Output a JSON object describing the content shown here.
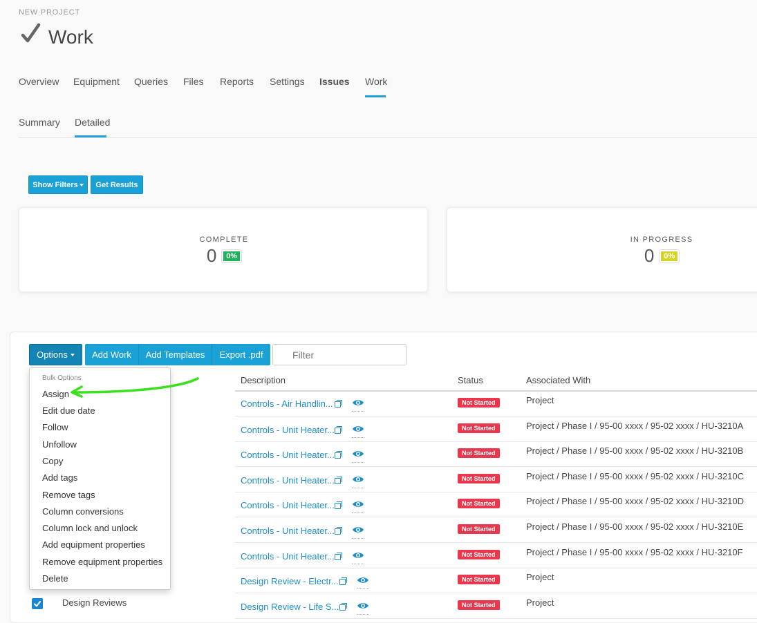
{
  "header": {
    "overline": "NEW PROJECT",
    "title": "Work"
  },
  "tabs": [
    "Overview",
    "Equipment",
    "Queries",
    "Files",
    "Reports",
    "Settings",
    "Issues",
    "Work"
  ],
  "subtabs": [
    "Summary",
    "Detailed"
  ],
  "buttons": {
    "show_filters": "Show Filters",
    "get_results": "Get Results"
  },
  "stats": {
    "complete": {
      "label": "COMPLETE",
      "value": "0",
      "pct": "0%",
      "color": "#1bb35a"
    },
    "in_progress": {
      "label": "IN PROGRESS",
      "value": "0",
      "pct": "0%",
      "color": "#d6d32a"
    }
  },
  "toolbar": {
    "options": "Options",
    "add_work": "Add Work",
    "add_templates": "Add Templates",
    "export": "Export .pdf",
    "filter_placeholder": "Filter"
  },
  "table": {
    "headers": {
      "description": "Description",
      "status": "Status",
      "associated": "Associated With"
    },
    "rows": [
      {
        "group": "",
        "desc": "Controls - Air Handlin...",
        "status": "Not Started",
        "assoc": "Project"
      },
      {
        "group": "",
        "desc": "Controls - Unit Heater...",
        "status": "Not Started",
        "assoc": "Project / Phase I / 95-00 xxxx / 95-02 xxxx / HU-3210A"
      },
      {
        "group": "",
        "desc": "Controls - Unit Heater...",
        "status": "Not Started",
        "assoc": "Project / Phase I / 95-00 xxxx / 95-02 xxxx / HU-3210B"
      },
      {
        "group": "",
        "desc": "Controls - Unit Heater...",
        "status": "Not Started",
        "assoc": "Project / Phase I / 95-00 xxxx / 95-02 xxxx / HU-3210C"
      },
      {
        "group": "",
        "desc": "Controls - Unit Heater...",
        "status": "Not Started",
        "assoc": "Project / Phase I / 95-00 xxxx / 95-02 xxxx / HU-3210D"
      },
      {
        "group": "",
        "desc": "Controls - Unit Heater...",
        "status": "Not Started",
        "assoc": "Project / Phase I / 95-00 xxxx / 95-02 xxxx / HU-3210E"
      },
      {
        "group": "",
        "desc": "Controls - Unit Heater...",
        "status": "Not Started",
        "assoc": "Project / Phase I / 95-00 xxxx / 95-02 xxxx / HU-3210F"
      },
      {
        "group": "",
        "desc": "Design Review - Electr...",
        "status": "Not Started",
        "assoc": "Project"
      },
      {
        "group": "Design Reviews",
        "desc": "Design Review - Life S...",
        "status": "Not Started",
        "assoc": "Project"
      }
    ]
  },
  "bulk_menu": {
    "header": "Bulk Options",
    "items": [
      "Assign",
      "Edit due date",
      "Follow",
      "Unfollow",
      "Copy",
      "Add tags",
      "Remove tags",
      "Column conversions",
      "Column lock and unlock",
      "Add equipment properties",
      "Remove equipment properties",
      "Delete"
    ]
  },
  "icons": {
    "title": "checkmark-icon",
    "copy": "copy-icon",
    "view": "eye-icon"
  },
  "colors": {
    "accent": "#1aa1d6",
    "link": "#1e8fc6",
    "status_not_started": "#e9374e",
    "annotation_arrow": "#3be01e"
  }
}
